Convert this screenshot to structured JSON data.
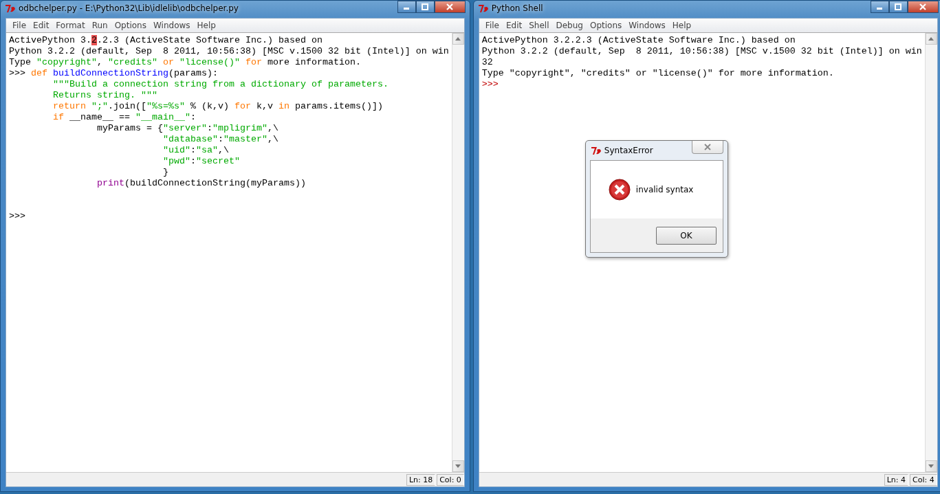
{
  "windows": [
    {
      "title": "odbchelper.py - E:\\Python32\\Lib\\idlelib\\odbchelper.py",
      "menu": [
        "File",
        "Edit",
        "Format",
        "Run",
        "Options",
        "Windows",
        "Help"
      ],
      "lines": [
        {
          "kind": "code",
          "segments": [
            {
              "text": "ActivePython 3.",
              "kind": "plain"
            },
            {
              "text": "2",
              "kind": "highlight"
            },
            {
              "text": ".2.3 (ActiveState Software Inc.) based on",
              "kind": "plain"
            }
          ]
        },
        {
          "kind": "code",
          "segments": [
            {
              "text": "Python 3.2.2 (default, Sep  8 2011, 10:56:38) [MSC v.1500 32 bit (Intel)] on win",
              "kind": "plain"
            }
          ]
        },
        {
          "kind": "code",
          "segments": [
            {
              "text": "Type ",
              "kind": "plain"
            },
            {
              "text": "\"copyright\"",
              "kind": "string"
            },
            {
              "text": ", ",
              "kind": "plain"
            },
            {
              "text": "\"credits\"",
              "kind": "string"
            },
            {
              "text": " or ",
              "kind": "keyword"
            },
            {
              "text": "\"license()\"",
              "kind": "string"
            },
            {
              "text": " for",
              "kind": "keyword"
            },
            {
              "text": " more information.",
              "kind": "plain"
            }
          ]
        },
        {
          "kind": "code",
          "segments": [
            {
              "text": ">>> ",
              "kind": "plain"
            },
            {
              "text": "def",
              "kind": "keyword"
            },
            {
              "text": " buildConnectionString",
              "kind": "definition"
            },
            {
              "text": "(params):",
              "kind": "plain"
            }
          ]
        },
        {
          "kind": "code",
          "segments": [
            {
              "text": "        \"\"\"Build a connection string from a dictionary of parameters.",
              "kind": "string"
            }
          ]
        },
        {
          "kind": "code",
          "segments": [
            {
              "text": "        Returns string. \"\"\"",
              "kind": "string"
            }
          ]
        },
        {
          "kind": "code",
          "segments": [
            {
              "text": "        return",
              "kind": "keyword"
            },
            {
              "text": " \";\"",
              "kind": "string"
            },
            {
              "text": ".join([",
              "kind": "plain"
            },
            {
              "text": "\"%s=%s\"",
              "kind": "string"
            },
            {
              "text": " % (k,v) ",
              "kind": "plain"
            },
            {
              "text": "for",
              "kind": "keyword"
            },
            {
              "text": " k,v ",
              "kind": "plain"
            },
            {
              "text": "in",
              "kind": "keyword"
            },
            {
              "text": " params.items()])",
              "kind": "plain"
            }
          ]
        },
        {
          "kind": "code",
          "segments": [
            {
              "text": "        if",
              "kind": "keyword"
            },
            {
              "text": " __name__ == ",
              "kind": "plain"
            },
            {
              "text": "\"__main__\"",
              "kind": "string"
            },
            {
              "text": ":",
              "kind": "plain"
            }
          ]
        },
        {
          "kind": "code",
          "segments": [
            {
              "text": "                myParams = {",
              "kind": "plain"
            },
            {
              "text": "\"server\"",
              "kind": "string"
            },
            {
              "text": ":",
              "kind": "plain"
            },
            {
              "text": "\"mpligrim\"",
              "kind": "string"
            },
            {
              "text": ",\\",
              "kind": "plain"
            }
          ]
        },
        {
          "kind": "code",
          "segments": [
            {
              "text": "                            \"database\"",
              "kind": "string"
            },
            {
              "text": ":",
              "kind": "plain"
            },
            {
              "text": "\"master\"",
              "kind": "string"
            },
            {
              "text": ",\\",
              "kind": "plain"
            }
          ]
        },
        {
          "kind": "code",
          "segments": [
            {
              "text": "                            \"uid\"",
              "kind": "string"
            },
            {
              "text": ":",
              "kind": "plain"
            },
            {
              "text": "\"sa\"",
              "kind": "string"
            },
            {
              "text": ",\\",
              "kind": "plain"
            }
          ]
        },
        {
          "kind": "code",
          "segments": [
            {
              "text": "                            \"pwd\"",
              "kind": "string"
            },
            {
              "text": ":",
              "kind": "plain"
            },
            {
              "text": "\"secret\"",
              "kind": "string"
            }
          ]
        },
        {
          "kind": "code",
          "segments": [
            {
              "text": "                            }",
              "kind": "plain"
            }
          ]
        },
        {
          "kind": "code",
          "segments": [
            {
              "text": "                print",
              "kind": "builtin"
            },
            {
              "text": "(buildConnectionString(myParams))",
              "kind": "plain"
            }
          ]
        },
        {
          "kind": "blank"
        },
        {
          "kind": "blank"
        },
        {
          "kind": "code",
          "segments": [
            {
              "text": ">>>",
              "kind": "plain"
            }
          ]
        }
      ],
      "status": {
        "line": "Ln: 18",
        "column": "Col: 0"
      }
    },
    {
      "title": "Python Shell",
      "menu": [
        "File",
        "Edit",
        "Shell",
        "Debug",
        "Options",
        "Windows",
        "Help"
      ],
      "lines": [
        {
          "kind": "code",
          "segments": [
            {
              "text": "ActivePython 3.2.2.3 (ActiveState Software Inc.) based on",
              "kind": "plain"
            }
          ]
        },
        {
          "kind": "code",
          "segments": [
            {
              "text": "Python 3.2.2 (default, Sep  8 2011, 10:56:38) [MSC v.1500 32 bit (Intel)] on win",
              "kind": "plain"
            }
          ]
        },
        {
          "kind": "code",
          "segments": [
            {
              "text": "32",
              "kind": "plain"
            }
          ]
        },
        {
          "kind": "code",
          "segments": [
            {
              "text": "Type \"copyright\", \"credits\" or \"license()\" for more information.",
              "kind": "plain"
            }
          ]
        },
        {
          "kind": "code",
          "segments": [
            {
              "text": ">>>",
              "kind": "prompt"
            }
          ]
        }
      ],
      "status": {
        "line": "Ln: 4",
        "column": "Col: 4"
      },
      "dialog": {
        "title": "SyntaxError",
        "message": "invalid syntax",
        "button": "OK"
      }
    }
  ]
}
